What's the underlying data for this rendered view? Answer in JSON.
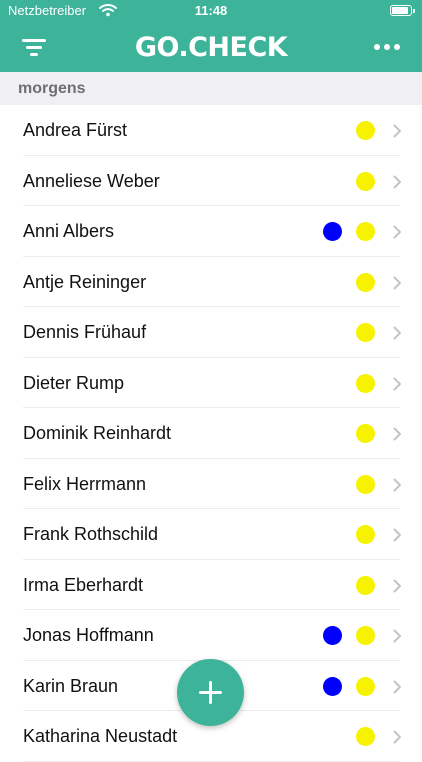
{
  "status_bar": {
    "carrier": "Netzbetreiber",
    "time": "11:48",
    "battery_level": 0.95
  },
  "nav": {
    "title": "GO.CHECK",
    "left_icon": "menu-filter-icon",
    "right_icon": "more-horizontal-icon"
  },
  "section": {
    "title": "morgens"
  },
  "list": {
    "items": [
      {
        "name": "Andrea Fürst",
        "blue": false,
        "yellow": true
      },
      {
        "name": "Anneliese Weber",
        "blue": false,
        "yellow": true
      },
      {
        "name": "Anni Albers",
        "blue": true,
        "yellow": true
      },
      {
        "name": "Antje Reininger",
        "blue": false,
        "yellow": true
      },
      {
        "name": "Dennis Frühauf",
        "blue": false,
        "yellow": true
      },
      {
        "name": "Dieter Rump",
        "blue": false,
        "yellow": true
      },
      {
        "name": "Dominik Reinhardt",
        "blue": false,
        "yellow": true
      },
      {
        "name": "Felix Herrmann",
        "blue": false,
        "yellow": true
      },
      {
        "name": "Frank Rothschild",
        "blue": false,
        "yellow": true
      },
      {
        "name": "Irma Eberhardt",
        "blue": false,
        "yellow": true
      },
      {
        "name": "Jonas Hoffmann",
        "blue": true,
        "yellow": true
      },
      {
        "name": "Karin Braun",
        "blue": true,
        "yellow": true
      },
      {
        "name": "Katharina Neustadt",
        "blue": false,
        "yellow": true
      }
    ]
  },
  "fab": {
    "icon": "plus-icon"
  },
  "colors": {
    "accent": "#3db39a",
    "status_yellow": "#f7f200",
    "status_blue": "#0000ff"
  }
}
